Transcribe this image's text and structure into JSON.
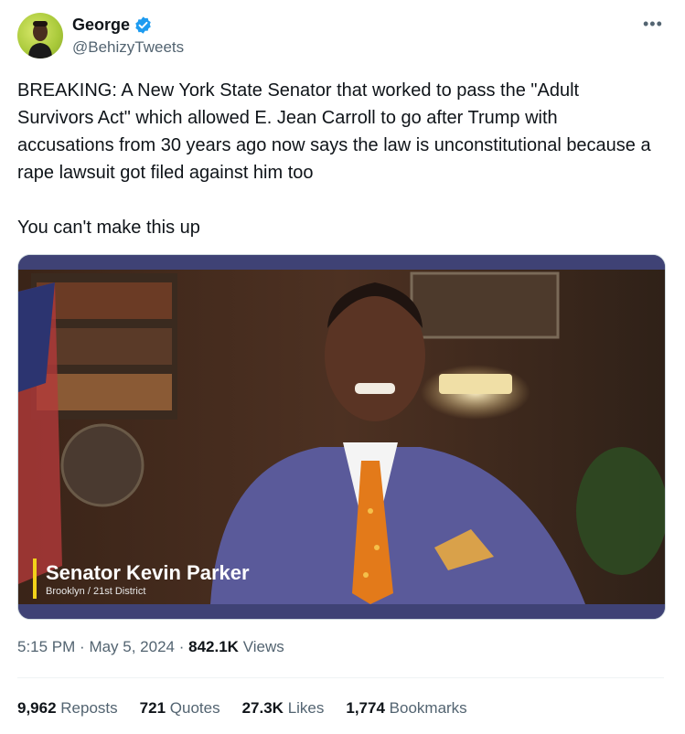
{
  "author": {
    "name": "George",
    "handle": "@BehizyTweets",
    "verified_icon": "verified-badge-icon",
    "verified_color": "#1d9bf0"
  },
  "more_icon": "more-icon",
  "tweet_text": "BREAKING: A New York State Senator that worked to pass the \"Adult Survivors Act\" which allowed E. Jean Carroll to go after Trump with accusations from 30 years ago now says the law is unconstitutional because a rape lawsuit got filed against him too\n\nYou can't make this up",
  "media": {
    "lower_third_name": "Senator Kevin Parker",
    "lower_third_subtitle": "Brooklyn / 21st District",
    "accent_color": "#f2d21a"
  },
  "meta": {
    "time": "5:15 PM",
    "date": "May 5, 2024",
    "views_count": "842.1K",
    "views_label": "Views"
  },
  "stats": {
    "reposts_count": "9,962",
    "reposts_label": "Reposts",
    "quotes_count": "721",
    "quotes_label": "Quotes",
    "likes_count": "27.3K",
    "likes_label": "Likes",
    "bookmarks_count": "1,774",
    "bookmarks_label": "Bookmarks"
  }
}
